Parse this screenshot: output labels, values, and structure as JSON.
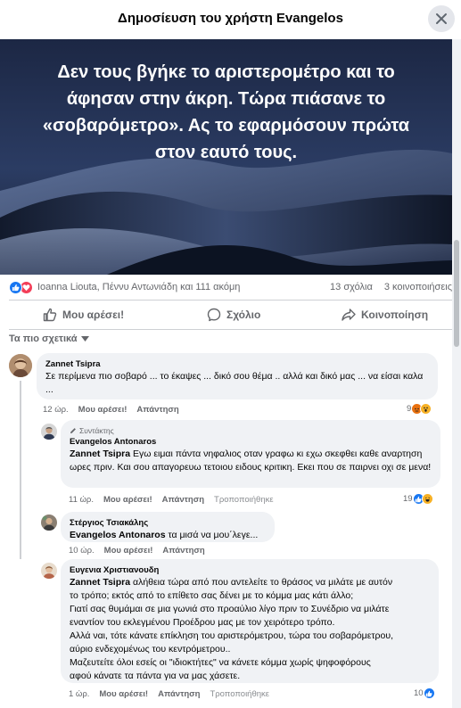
{
  "dialog": {
    "title": "Δημοσίευση του χρήστη Evangelos"
  },
  "post": {
    "text": "Δεν τους βγήκε το αριστερομέτρο και το άφησαν στην άκρη. Τώρα πιάσανε το «σοβαρόμετρο». Ας το εφαρμόσουν πρώτα στον εαυτό τους.",
    "reaction_names": "Ioanna Liouta, Πέννυ Αντωνιάδη και 111 ακόμη",
    "comments_count": "13 σχόλια",
    "shares_count": "3 κοινοποιήσεις",
    "reaction_icons": [
      "like-icon",
      "love-icon"
    ]
  },
  "actions": {
    "like": "Μου αρέσει!",
    "comment": "Σχόλιο",
    "share": "Κοινοποίηση"
  },
  "sort": {
    "label": "Τα πιο σχετικά"
  },
  "comments": [
    {
      "name": "Zannet Tsipra",
      "text": "Σε περίμενα πιο σοβαρό ... το έκαψες ... δικό σου θέμα .. αλλά και δικό μας ... να είσαι καλα ...",
      "time": "12 ώρ.",
      "like": "Μου αρέσει!",
      "reply": "Απάντηση",
      "reaction_count": "9",
      "reaction_icons": [
        "angry-icon",
        "wow-icon"
      ]
    },
    {
      "badge": "Συντάκτης",
      "name": "Evangelos Antonaros",
      "mention": "Zannet Tsipra",
      "text": " Εγω ειμαι πάντα νηφαλιος οταν γραφω κι εχω σκεφθει καθε αναρτηση ωρες πριν. Και σου απαγορευω τετοιου ειδους κριτικη. Εκει που σε παιρνει οχι σε μενα!",
      "time": "11 ώρ.",
      "like": "Μου αρέσει!",
      "reply": "Απάντηση",
      "edited": "Τροποποιήθηκε",
      "reaction_count": "19",
      "reaction_icons": [
        "like-icon",
        "haha-icon"
      ]
    },
    {
      "name": "Στέργιος Τσιακάλης",
      "mention": "Evangelos Antonaros",
      "text": " τα μισά να μου΄λεγε...",
      "time": "10 ώρ.",
      "like": "Μου αρέσει!",
      "reply": "Απάντηση"
    },
    {
      "name": "Ευγενια Χριστιανουδη",
      "mention": "Zannet Tsipra",
      "lines": [
        " αλήθεια τώρα από που αντελείτε το θράσος να μιλάτε με αυτόν",
        "το τρόπο; εκτός από το επίθετο σας δένει με το κόμμα μας κάτι άλλο;",
        "Γιατί σας θυμάμαι σε μια γωνιά στο προαύλιο λίγο πριν το Συνέδριο να μιλάτε",
        "εναντίον του εκλεγμένου Προέδρου μας με τον χειρότερο τρόπο.",
        "Αλλά ναι, τότε κάνατε επίκληση του αριστερόμετρου, τώρα του σοβαρόμετρου,",
        "αύριο ενδεχομένως του κεντρόμετρου..",
        "Μαζευτείτε όλοι εσείς οι \"ιδιοκτήτες\" να κάνετε κόμμα χωρίς ψηφοφόρους",
        "αφού κάνατε τα πάντα για να μας χάσετε."
      ],
      "time": "1 ώρ.",
      "like": "Μου αρέσει!",
      "reply": "Απάντηση",
      "edited": "Τροποποιήθηκε",
      "reaction_count": "10",
      "reaction_icons": [
        "like-icon"
      ]
    }
  ],
  "colors": {
    "facebook_blue": "#1877f2",
    "love_red": "#f33e58",
    "bubble_bg": "#f0f2f5",
    "secondary_text": "#65676b"
  }
}
